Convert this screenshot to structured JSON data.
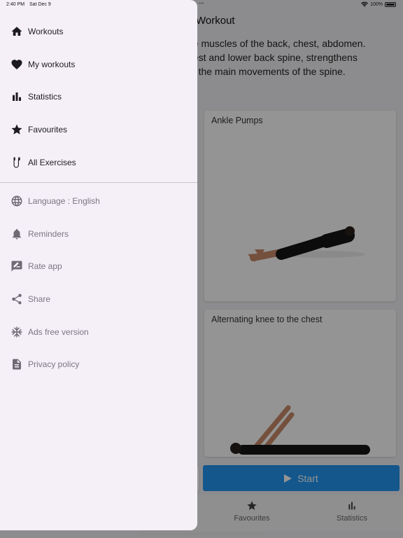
{
  "status_bar": {
    "time": "2:40 PM",
    "date": "Sat Dec 9",
    "dots": "•••",
    "battery": "100%"
  },
  "app": {
    "title": "Workout",
    "description_lines": [
      "he muscles of the back, chest, abdomen.",
      "hest and lower back spine, strengthens",
      "of the main movements of the spine."
    ],
    "cards": [
      {
        "title": "Ankle Pumps"
      },
      {
        "title": "Alternating knee to the chest"
      }
    ],
    "start_label": "Start",
    "bottom_nav": [
      {
        "label": "Favourites",
        "icon": "star-icon"
      },
      {
        "label": "Statistics",
        "icon": "bar-chart-icon"
      }
    ]
  },
  "drawer": {
    "primary_items": [
      {
        "label": "Workouts",
        "icon": "home-icon"
      },
      {
        "label": "My workouts",
        "icon": "heart-icon"
      },
      {
        "label": "Statistics",
        "icon": "bar-chart-icon"
      },
      {
        "label": "Favourites",
        "icon": "star-icon"
      },
      {
        "label": "All Exercises",
        "icon": "jump-rope-icon"
      }
    ],
    "secondary_items": [
      {
        "label": "Language : English",
        "icon": "globe-icon"
      },
      {
        "label": "Reminders",
        "icon": "bell-icon"
      },
      {
        "label": "Rate app",
        "icon": "rate-review-icon"
      },
      {
        "label": "Share",
        "icon": "share-icon"
      },
      {
        "label": "Ads free version",
        "icon": "snowflake-icon"
      },
      {
        "label": "Privacy policy",
        "icon": "document-icon"
      }
    ]
  },
  "colors": {
    "accent": "#2196f3",
    "drawer_bg": "#f5f0f8",
    "primary_text": "#1c1b1f",
    "secondary_text": "#7a7680"
  }
}
